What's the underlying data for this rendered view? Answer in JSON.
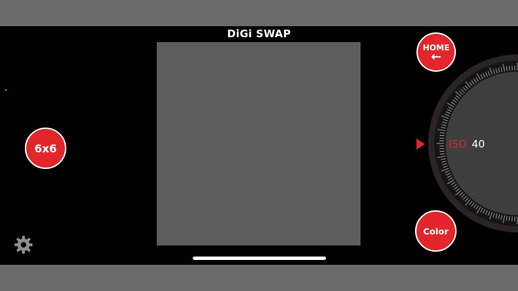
{
  "app": {
    "title": "DiGi SWAP"
  },
  "buttons": {
    "format_label": "6x6",
    "home_label": "HOME",
    "home_arrow": "←",
    "color_label": "Color"
  },
  "dial": {
    "parameter_label": "ISO",
    "parameter_value": "40"
  },
  "icons": {
    "settings": "gear-icon",
    "dial_pointer": "triangle-right-icon",
    "back": "arrow-left-icon"
  },
  "colors": {
    "accent": "#e3262b",
    "viewfinder": "#5d5d5d",
    "background": "#000000",
    "status_dot": "#2e9c3a"
  }
}
